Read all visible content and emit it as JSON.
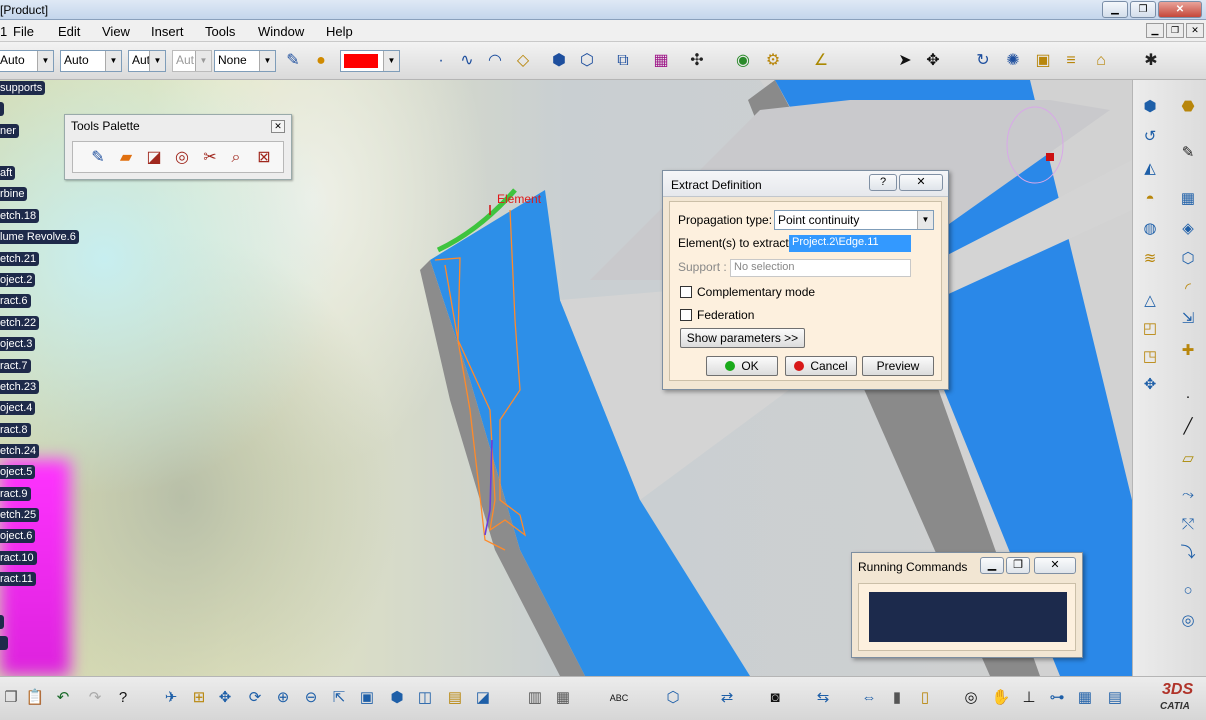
{
  "window": {
    "title": "[Product]"
  },
  "menu": {
    "items": [
      "File",
      "Edit",
      "View",
      "Insert",
      "Tools",
      "Window",
      "Help"
    ]
  },
  "toolbar_top": {
    "combos": [
      {
        "name": "line-color-combo",
        "value": "Auto",
        "disabled": false
      },
      {
        "name": "line-type-combo",
        "value": "Auto",
        "disabled": false
      },
      {
        "name": "line-thickness-combo",
        "value": "Aut",
        "disabled": false
      },
      {
        "name": "point-type-combo",
        "value": "Aut",
        "disabled": true
      },
      {
        "name": "layer-combo",
        "value": "None",
        "disabled": false
      }
    ],
    "fill_color": "#ff0000"
  },
  "tree": {
    "items": [
      "supports",
      "ner",
      "aft",
      "rbine",
      "etch.18",
      "lume Revolve.6",
      "etch.21",
      "oject.2",
      "ract.6",
      "etch.22",
      "oject.3",
      "ract.7",
      "etch.23",
      "oject.4",
      "ract.8",
      "etch.24",
      "oject.5",
      "ract.9",
      "etch.25",
      "oject.6",
      "ract.10",
      "ract.11"
    ]
  },
  "viewport": {
    "element_label": "Element"
  },
  "tools_palette": {
    "title": "Tools Palette"
  },
  "extract_dialog": {
    "title": "Extract Definition",
    "propagation_label": "Propagation type:",
    "propagation_value": "Point continuity",
    "elements_label": "Element(s) to extract",
    "elements_value": "Project.2\\Edge.11",
    "support_label": "Support :",
    "support_value": "No selection",
    "complementary_label": "Complementary mode",
    "federation_label": "Federation",
    "show_params_label": "Show parameters >>",
    "ok_label": "OK",
    "cancel_label": "Cancel",
    "preview_label": "Preview"
  },
  "running_commands": {
    "title": "Running Commands"
  },
  "colors": {
    "accent_blue": "#2a7fe0",
    "selection_blue": "#3399ff",
    "dialog_bg": "#f2e6d3"
  }
}
